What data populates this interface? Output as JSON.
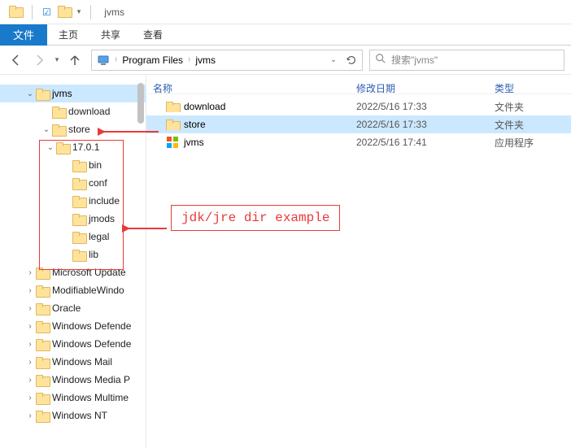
{
  "window": {
    "title": "jvms"
  },
  "ribbon": {
    "file": "文件",
    "home": "主页",
    "share": "共享",
    "view": "查看"
  },
  "breadcrumb": {
    "seg1": "Program Files",
    "seg2": "jvms"
  },
  "search": {
    "placeholder": "搜索\"jvms\""
  },
  "columns": {
    "name": "名称",
    "date": "修改日期",
    "type": "类型"
  },
  "files": {
    "r0": {
      "name": "download",
      "date": "2022/5/16 17:33",
      "type": "文件夹"
    },
    "r1": {
      "name": "store",
      "date": "2022/5/16 17:33",
      "type": "文件夹"
    },
    "r2": {
      "name": "jvms",
      "date": "2022/5/16 17:41",
      "type": "应用程序"
    }
  },
  "tree": {
    "jvms": "jvms",
    "download": "download",
    "store": "store",
    "v1701": "17.0.1",
    "bin": "bin",
    "conf": "conf",
    "include": "include",
    "jmods": "jmods",
    "legal": "legal",
    "lib": "lib",
    "msupdate": "Microsoft Update",
    "modwin": "ModifiableWindo",
    "oracle": "Oracle",
    "wd1": "Windows Defende",
    "wd2": "Windows Defende",
    "wmail": "Windows Mail",
    "wmedia": "Windows Media P",
    "wmulti": "Windows Multime",
    "wnt": "Windows NT"
  },
  "annotation": {
    "text": "jdk/jre dir example"
  }
}
